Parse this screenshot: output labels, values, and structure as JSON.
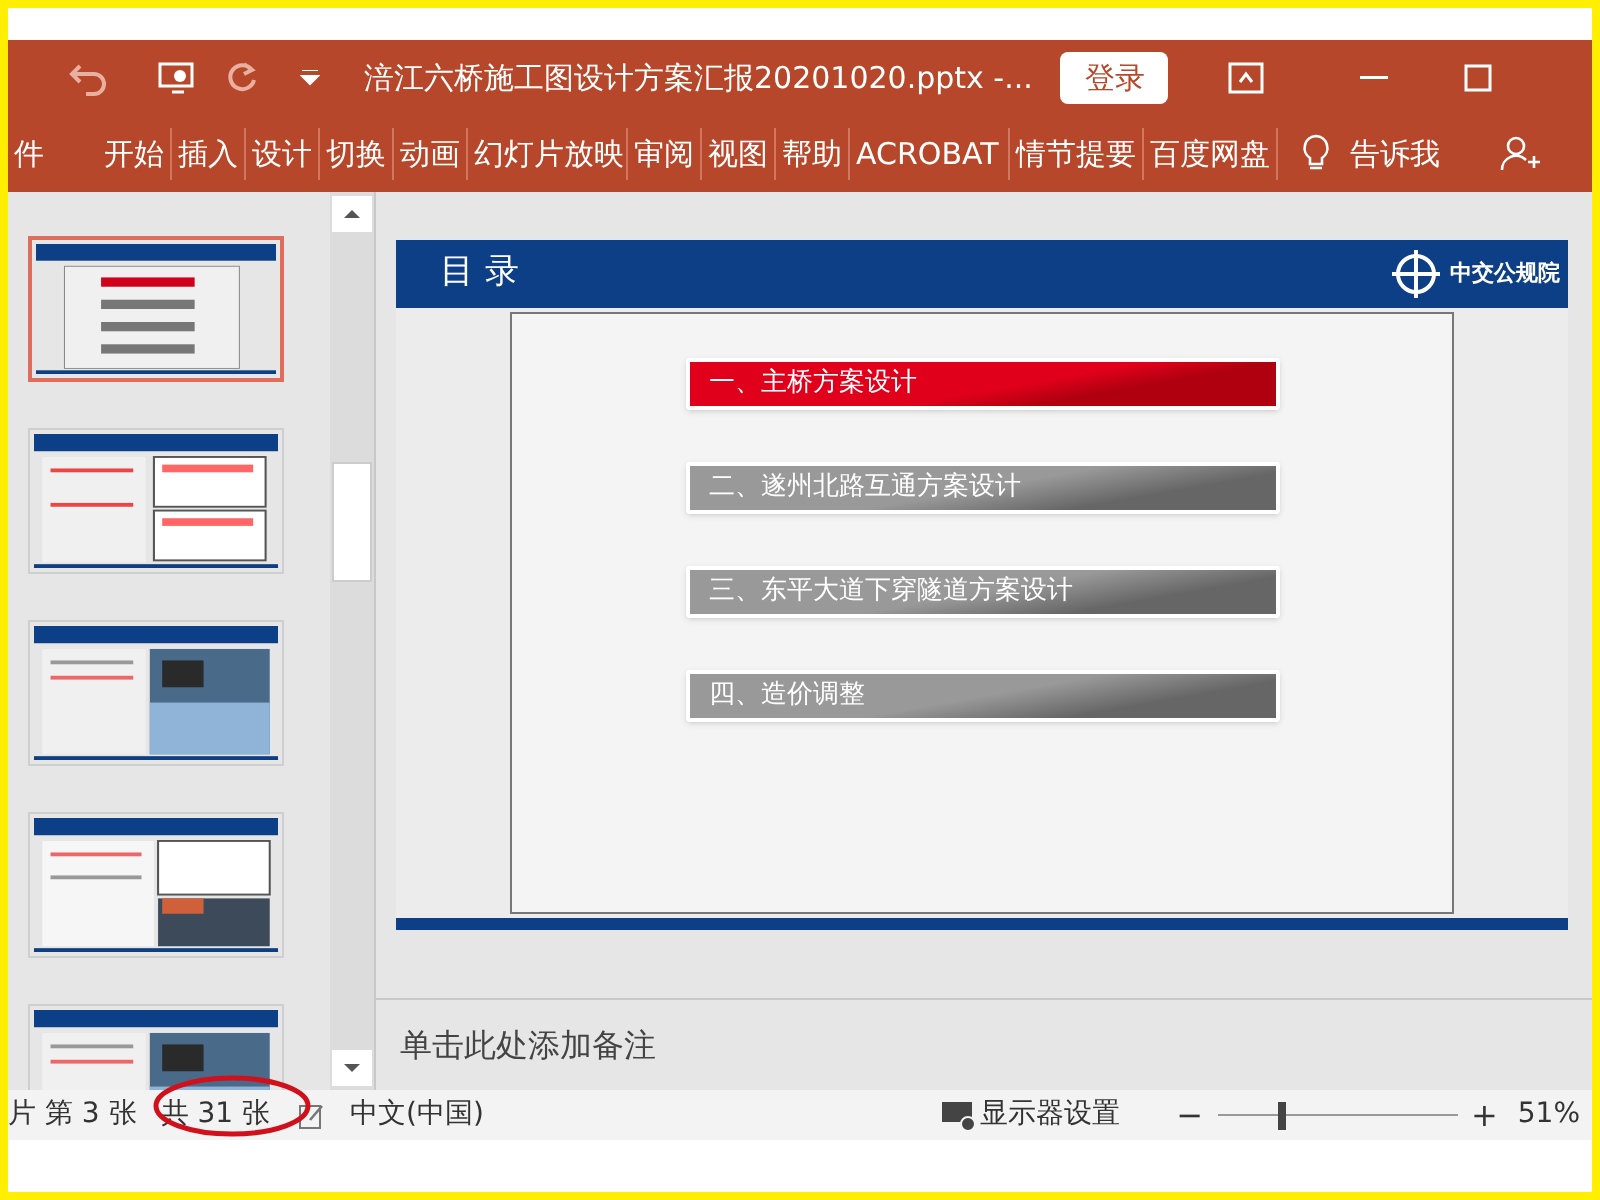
{
  "title_bar": {
    "title": "涪江六桥施工图设计方案汇报20201020.pptx  -...",
    "login": "登录"
  },
  "ribbon_tabs": [
    {
      "label": "件",
      "selected": false
    },
    {
      "label": "开始",
      "selected": false
    },
    {
      "label": "插入",
      "selected": false
    },
    {
      "label": "设计",
      "selected": false
    },
    {
      "label": "切换",
      "selected": false
    },
    {
      "label": "动画",
      "selected": false
    },
    {
      "label": "幻灯片放映",
      "selected": false
    },
    {
      "label": "审阅",
      "selected": false
    },
    {
      "label": "视图",
      "selected": false
    },
    {
      "label": "帮助",
      "selected": false
    },
    {
      "label": "ACROBAT",
      "selected": false
    },
    {
      "label": "情节提要",
      "selected": false
    },
    {
      "label": "百度网盘",
      "selected": false
    }
  ],
  "tell_me": "告诉我",
  "thumbnails": [
    {
      "kind": "toc",
      "selected": true
    },
    {
      "kind": "docs",
      "selected": false
    },
    {
      "kind": "photo",
      "selected": false
    },
    {
      "kind": "mixed",
      "selected": false
    },
    {
      "kind": "photo",
      "selected": false
    }
  ],
  "slide": {
    "heading": "目 录",
    "logo": "中交公规院",
    "items": [
      {
        "text": "一、主桥方案设计",
        "selected": true
      },
      {
        "text": "二、遂州北路互通方案设计",
        "selected": false
      },
      {
        "text": "三、东平大道下穿隧道方案设计",
        "selected": false
      },
      {
        "text": "四、造价调整",
        "selected": false
      }
    ]
  },
  "notes_placeholder": "单击此处添加备注",
  "status_bar": {
    "slide_number": "片 第 3 张",
    "slide_count": "共 31 张",
    "language": "中文(中国)",
    "display_settings": "显示器设置",
    "zoom_out": "−",
    "zoom_in": "+",
    "zoom": "51%",
    "level": 0.26
  }
}
